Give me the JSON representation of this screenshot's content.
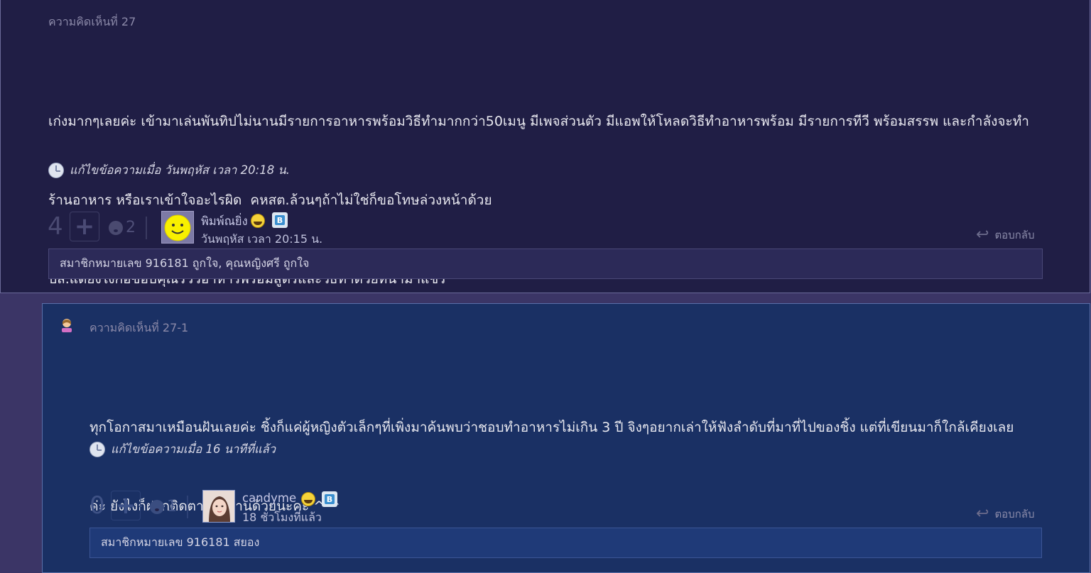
{
  "comment_27": {
    "number_label": "ความคิดเห็นที่ 27",
    "body_lines": [
      "เก่งมากๆเลยค่ะ เข้ามาเล่นพันทิปไม่นานมีรายการอาหารพร้อมวิธีทำมากกว่า50เมนู มีเพจส่วนตัว มีแอพให้โหลดวิธีทำอาหารพร้อม มีรายการทีวี พร้อมสรรพ และกำลังจะทำ",
      "ร้านอาหาร หรือเราเข้าใจอะไรผิด  คหสต.ล้วนๆถ้าไม่ใช่ก็ขอโทษล่วงหน้าด้วย",
      "ปล.แต่ยังไงก้อขอบคุณรีวิวอาหารพร้อมสูตรและวิธีทำด้วยที่นำมาแชร์"
    ],
    "edited_label": "แก้ไขข้อความเมื่อ วันพฤหัส เวลา 20:18 น.",
    "vote_count": "4",
    "emotion_count": "2",
    "author": "พิมพ์ณยิ่ง",
    "timestamp": "วันพฤหัส เวลา 20:15 น.",
    "reply_label": "ตอบกลับ",
    "likers": "สมาชิกหมายเลข 916181 ถูกใจ, คุณหญิงศรี ถูกใจ"
  },
  "comment_27_1": {
    "number_label": "ความคิดเห็นที่ 27-1",
    "body_lines": [
      "ทุกโอกาสมาเหมือนฝันเลยค่ะ ชิ้งก็แค่ผู้หญิงตัวเล็กๆที่เพิ่งมาค้นพบว่าชอบทำอาหารไม่เกิน 3 ปี จิงๆอยากเล่าให้ฟังลำดับที่มาที่ไปของชิ้ง แต่ที่เขียนมาก็ใกล้เคียงเลย",
      "ค่ะ ยังไงก็ฝากติดตามผลงานด้วยนะคะ ^ ^"
    ],
    "edited_label": "แก้ไขข้อความเมื่อ 16 นาทีที่แล้ว",
    "vote_count": "0",
    "emotion_count": "1",
    "author": "candyme",
    "timestamp": "18 ชั่วโมงที่แล้ว",
    "reply_label": "ตอบกลับ",
    "likers": "สมาชิกหมายเลข 916181 สยอง"
  },
  "icons": {
    "plus": "plus-icon",
    "emotion": "emotion-face-icon",
    "edit": "clock-edit-icon",
    "reply": "reply-arrow-icon",
    "smile_badge": "smile-badge-icon",
    "blog_badge": "blog-badge-icon"
  },
  "colors": {
    "comment_bg": "#201e45",
    "reply_bg": "#1a3064",
    "page_bg": "#3b3566"
  }
}
